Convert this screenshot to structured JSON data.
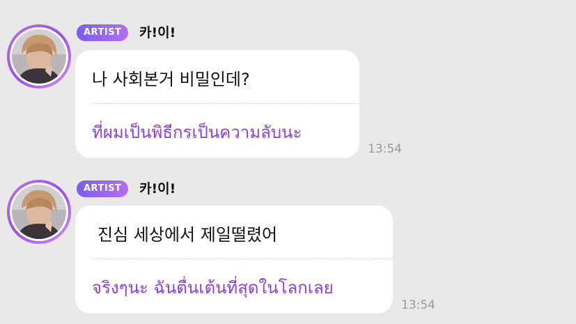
{
  "colors": {
    "background": "#e9e9ea",
    "bubble": "#ffffff",
    "translation_text": "#8d3fe0",
    "badge_gradient_start": "#7b5cf0",
    "badge_gradient_end": "#b070f2",
    "timestamp": "#9a9a9d"
  },
  "messages": [
    {
      "badge": "ARTIST",
      "sender": "카!이!",
      "text": "나 사회본거 비밀인데?",
      "translation": "ที่ผมเป็นพิธีกรเป็นความลับนะ",
      "time": "13:54",
      "avatar_icon": "artist-avatar"
    },
    {
      "badge": "ARTIST",
      "sender": "카!이!",
      "text": "진심 세상에서 제일떨렸어",
      "translation": "จริงๆนะ ฉันตื่นเต้นที่สุดในโลกเลย",
      "time": "13:54",
      "avatar_icon": "artist-avatar"
    }
  ]
}
